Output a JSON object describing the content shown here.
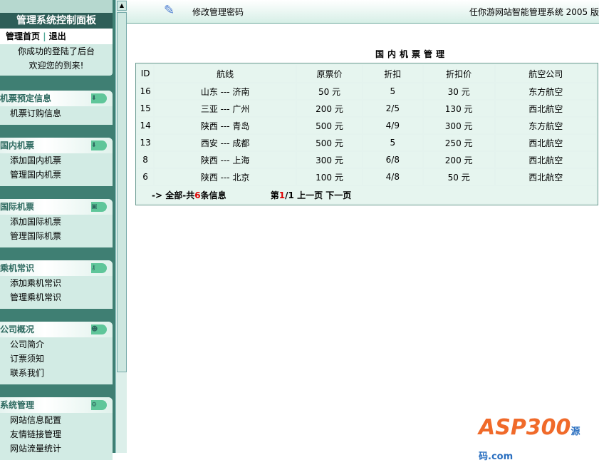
{
  "sidebar": {
    "title": "管理系统控制面板",
    "home": "管理首页",
    "sep": "|",
    "logout": "退出",
    "msg1": "你成功的登陆了后台",
    "msg2": "欢迎您的到来!",
    "sections": [
      {
        "title": "机票预定信息",
        "icon": "download-icon",
        "items": [
          "机票订购信息"
        ]
      },
      {
        "title": "国内机票",
        "icon": "download-icon",
        "items": [
          "添加国内机票",
          "管理国内机票"
        ]
      },
      {
        "title": "国际机票",
        "icon": "monitor-icon",
        "items": [
          "添加国际机票",
          "管理国际机票"
        ]
      },
      {
        "title": "乘机常识",
        "icon": "key-icon",
        "items": [
          "添加乘机常识",
          "管理乘机常识"
        ]
      },
      {
        "title": "公司概况",
        "icon": "users-icon",
        "items": [
          "公司简介",
          "订票须知",
          "联系我们"
        ]
      },
      {
        "title": "系统管理",
        "icon": "gear-icon",
        "items": [
          "网站信息配置",
          "友情链接管理",
          "网站流量统计"
        ]
      }
    ]
  },
  "top": {
    "change_password": "修改管理密码",
    "system_name": "任你游网站智能管理系统 2005 版"
  },
  "main": {
    "title": "国内机票管理",
    "headers": [
      "ID",
      "航线",
      "原票价",
      "折扣",
      "折扣价",
      "航空公司"
    ],
    "rows": [
      [
        "16",
        "山东 --- 济南",
        "50 元",
        "5",
        "30 元",
        "东方航空"
      ],
      [
        "15",
        "三亚 --- 广州",
        "200 元",
        "2/5",
        "130 元",
        "西北航空"
      ],
      [
        "14",
        "陕西 --- 青岛",
        "500 元",
        "4/9",
        "300 元",
        "东方航空"
      ],
      [
        "13",
        "西安 --- 成都",
        "500 元",
        "5",
        "250 元",
        "西北航空"
      ],
      [
        "8",
        "陕西 --- 上海",
        "300 元",
        "6/8",
        "200 元",
        "西北航空"
      ],
      [
        "6",
        "陕西 --- 北京",
        "100 元",
        "4/8",
        "50 元",
        "西北航空"
      ]
    ],
    "footer": {
      "prefix": "-> 全部-共",
      "count": "6",
      "suffix": "条信息",
      "page_prefix": "第",
      "page": "1",
      "page_total": "/1",
      "prev": "上一页",
      "next": "下一页"
    }
  },
  "watermark": {
    "text": "ASP300",
    "sub": "源码 .com"
  }
}
